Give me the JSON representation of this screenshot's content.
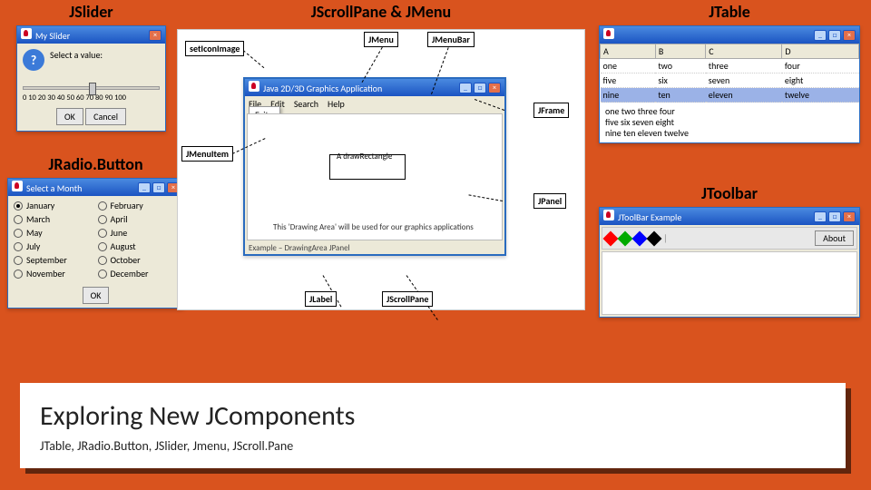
{
  "headings": {
    "jslider": "JSlider",
    "jscroll_menu": "JScrollPane & JMenu",
    "jtable": "JTable",
    "jradio": "JRadio.Button",
    "jtoolbar": "JToolbar"
  },
  "jslider": {
    "window_title": "My Slider",
    "prompt": "Select a value:",
    "ticks": "0 10 20 30 40 50 60 70 80 90 100",
    "ok": "OK",
    "cancel": "Cancel"
  },
  "jradio": {
    "window_title": "Select a Month",
    "months": [
      "January",
      "February",
      "March",
      "April",
      "May",
      "June",
      "July",
      "August",
      "September",
      "October",
      "November",
      "December"
    ],
    "selected_index": 0,
    "ok": "OK"
  },
  "middle": {
    "callouts": {
      "seticon": "setIconImage",
      "jmenu": "JMenu",
      "jmenubar": "JMenuBar",
      "jframe": "JFrame",
      "jmenuitem": "JMenuItem",
      "jpanel": "JPanel",
      "jlabel": "JLabel",
      "jscrollpane": "JScrollPane"
    },
    "app_title": "Java 2D/3D Graphics Application",
    "menu": [
      "File",
      "Edit",
      "Search",
      "Help"
    ],
    "menu_item": "Exit",
    "drawing_text": "A drawRectangle",
    "drawing_caption": "This 'Drawing Area' will be used for our graphics applications",
    "status": "Example – DrawingArea JPanel"
  },
  "jtable": {
    "window_title": "",
    "columns": [
      "A",
      "B",
      "C",
      "D"
    ],
    "rows": [
      [
        "one",
        "two",
        "three",
        "four"
      ],
      [
        "five",
        "six",
        "seven",
        "eight"
      ],
      [
        "nine",
        "ten",
        "eleven",
        "twelve"
      ]
    ],
    "selected_row": 2,
    "output": [
      "one two three four",
      "five six seven eight",
      "nine ten eleven twelve"
    ]
  },
  "jtoolbar": {
    "window_title": "JToolBar Example",
    "diamonds": [
      "red",
      "green",
      "blue",
      "black"
    ],
    "about": "About"
  },
  "footer": {
    "title": "Exploring New JComponents",
    "subtitle": "JTable, JRadio.Button, JSlider, Jmenu, JScroll.Pane"
  }
}
